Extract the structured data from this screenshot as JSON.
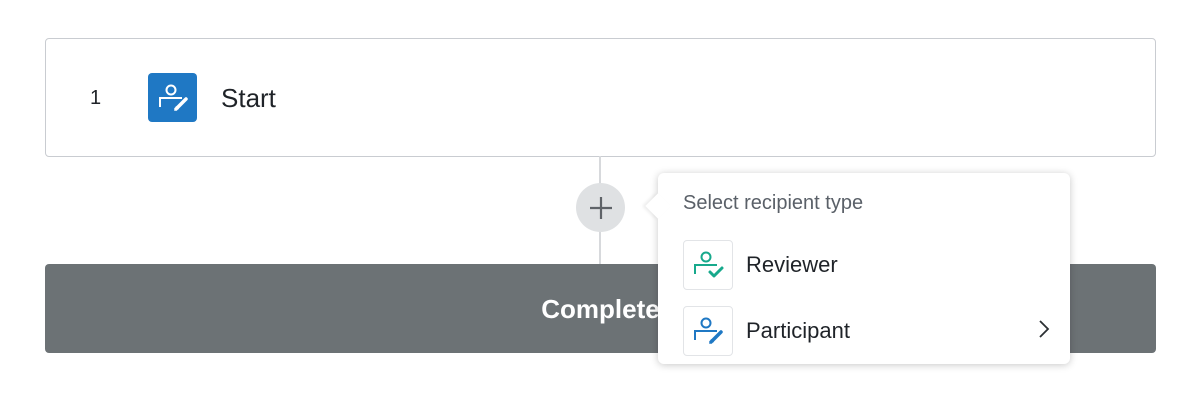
{
  "step": {
    "number": "1",
    "title": "Start",
    "icon": "participant-icon"
  },
  "add_button": {
    "icon": "plus-icon"
  },
  "complete_bar": {
    "label": "Complete"
  },
  "recipient_menu": {
    "title": "Select recipient type",
    "options": [
      {
        "label": "Reviewer",
        "icon": "reviewer-icon",
        "has_submenu": false
      },
      {
        "label": "Participant",
        "icon": "participant-icon",
        "has_submenu": true
      }
    ]
  },
  "colors": {
    "brand_blue": "#1f78c4",
    "reviewer_teal": "#17a98c",
    "complete_gray": "#6c7275",
    "add_button_gray": "#dfe1e3"
  }
}
